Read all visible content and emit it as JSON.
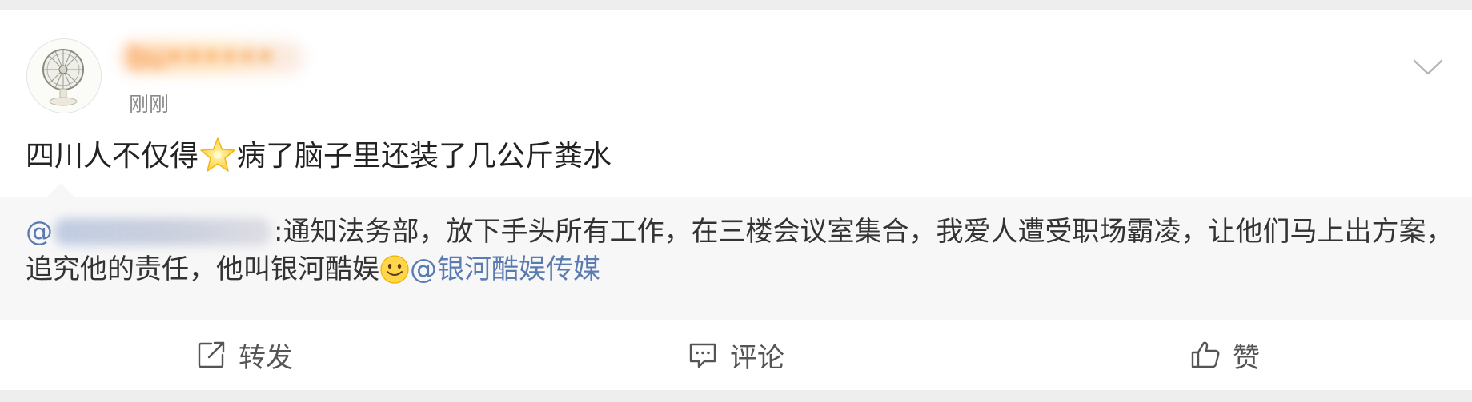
{
  "post": {
    "username": "bu••••••",
    "timestamp": "刚刚",
    "text_part1": "四川人不仅得",
    "text_emoji": "star-emoji",
    "text_part2": "病了脑子里还装了几公斤粪水"
  },
  "quote": {
    "mention_prefix": "@",
    "body_part1": ":通知法务部，放下手头所有工作，在三楼会议室集合，我爱人遭受职场霸凌，让他们马上出方案，追究他的责任，他叫银河酷娱",
    "emoji": "smile-emoji",
    "mention_visible": "@银河酷娱传媒"
  },
  "actions": {
    "repost_label": "转发",
    "comment_label": "评论",
    "like_label": "赞"
  },
  "colors": {
    "username": "#f28a2c",
    "mention": "#5a7bb0",
    "quote_bg": "#f7f7f7",
    "text": "#222222",
    "secondary_text": "#8a8a8a"
  }
}
